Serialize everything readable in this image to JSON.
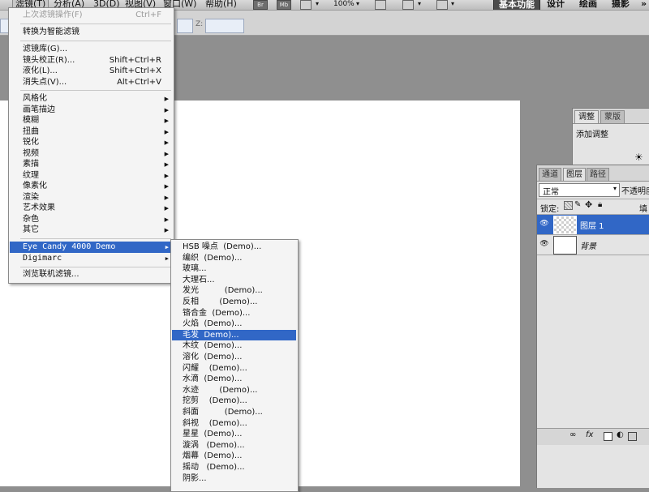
{
  "menubar": {
    "items": [
      {
        "label": "滤镜(T)",
        "active": true
      },
      {
        "label": "分析(A)"
      },
      {
        "label": "3D(D)"
      },
      {
        "label": "视图(V)"
      },
      {
        "label": "窗口(W)"
      },
      {
        "label": "帮助(H)"
      }
    ],
    "icons": [
      "Br",
      "Mb"
    ],
    "zoom": "100%",
    "workspaces": [
      {
        "label": "基本功能",
        "active": true
      },
      {
        "label": "设计"
      },
      {
        "label": "绘画"
      },
      {
        "label": "摄影"
      }
    ],
    "more": "»"
  },
  "options_bar": {
    "z_label": "Z:"
  },
  "filter_menu": {
    "last_filter": {
      "label": "上次滤镜操作(F)",
      "shortcut": "Ctrl+F"
    },
    "smart_filter": "转换为智能滤镜",
    "group1": [
      {
        "label": "滤镜库(G)..."
      },
      {
        "label": "镜头校正(R)...",
        "shortcut": "Shift+Ctrl+R"
      },
      {
        "label": "液化(L)...",
        "shortcut": "Shift+Ctrl+X"
      },
      {
        "label": "消失点(V)...",
        "shortcut": "Alt+Ctrl+V"
      }
    ],
    "categories": [
      "风格化",
      "画笔描边",
      "模糊",
      "扭曲",
      "锐化",
      "视频",
      "素描",
      "纹理",
      "像素化",
      "渲染",
      "艺术效果",
      "杂色",
      "其它"
    ],
    "plugins": [
      "Eye Candy 4000 Demo",
      "Digimarc"
    ],
    "browse_online": "浏览联机滤镜..."
  },
  "submenu": {
    "items": [
      "HSB 噪点  (Demo)...",
      "编织  (Demo)...",
      "玻璃...",
      "大理石...",
      "发光          (Demo)...",
      "反相        (Demo)...",
      "铬合金  (Demo)...",
      "火焰  (Demo)...",
      "毛发  Demo)...",
      "木纹  (Demo)...",
      "溶化  (Demo)...",
      "闪耀    (Demo)...",
      "水滴  (Demo)...",
      "水迹        (Demo)...",
      "挖剪    (Demo)...",
      "斜面          (Demo)...",
      "斜视    (Demo)...",
      "星星  (Demo)...",
      "漩涡   (Demo)...",
      "烟幕  (Demo)...",
      "摇动   (Demo)...",
      "阴影..."
    ],
    "highlighted_index": 8
  },
  "adjust_panel": {
    "tabs": [
      "调整",
      "蒙版"
    ],
    "title": "添加调整"
  },
  "layers_panel": {
    "tabs": [
      "通道",
      "图层",
      "路径"
    ],
    "blend_mode": "正常",
    "opacity_label": "不透明度",
    "lock_label": "锁定:",
    "fill_label": "填充",
    "layers": [
      {
        "name": "图层 1",
        "selected": true
      },
      {
        "name": "背景",
        "selected": false
      }
    ]
  },
  "colors": {
    "highlight": "#3167c6",
    "canvas": "#ffffff",
    "workspace_bg": "#8f8f8f"
  }
}
